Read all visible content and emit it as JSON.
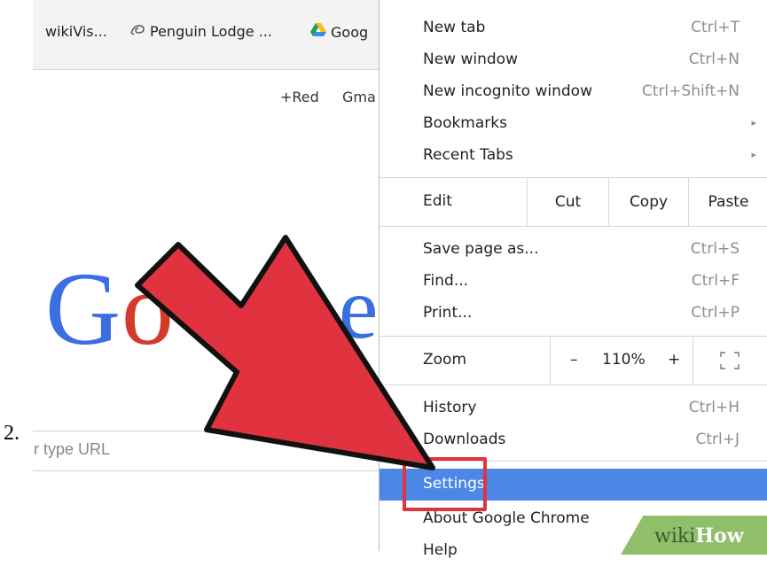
{
  "step": {
    "number": "2."
  },
  "bookmarks": {
    "items": [
      {
        "label": "wikiVis..."
      },
      {
        "label": "Penguin Lodge ..."
      },
      {
        "label": "Goog"
      }
    ]
  },
  "google_page": {
    "links": [
      "+Red",
      "Gma"
    ],
    "logo_visible_letters": [
      "G",
      "o",
      "e"
    ],
    "search_placeholder": "or type URL"
  },
  "menu": {
    "items_top": [
      {
        "label": "New tab",
        "shortcut": "Ctrl+T"
      },
      {
        "label": "New window",
        "shortcut": "Ctrl+N"
      },
      {
        "label": "New incognito window",
        "shortcut": "Ctrl+Shift+N"
      },
      {
        "label": "Bookmarks",
        "submenu": true
      },
      {
        "label": "Recent Tabs",
        "submenu": true
      }
    ],
    "edit": {
      "label": "Edit",
      "cut": "Cut",
      "copy": "Copy",
      "paste": "Paste"
    },
    "items_mid": [
      {
        "label": "Save page as...",
        "shortcut": "Ctrl+S"
      },
      {
        "label": "Find...",
        "shortcut": "Ctrl+F"
      },
      {
        "label": "Print...",
        "shortcut": "Ctrl+P"
      }
    ],
    "zoom": {
      "label": "Zoom",
      "minus": "–",
      "value": "110%",
      "plus": "+"
    },
    "items_bottom": [
      {
        "label": "History",
        "shortcut": "Ctrl+H"
      },
      {
        "label": "Downloads",
        "shortcut": "Ctrl+J"
      },
      {
        "label": "Settings",
        "highlighted": true
      },
      {
        "label": "About Google Chrome"
      },
      {
        "label": "Help"
      }
    ]
  },
  "watermark": {
    "prefix": "wiki",
    "suffix": "How"
  },
  "colors": {
    "arrow": "#e0333f",
    "highlight": "#4d87e6",
    "watermark": "#8fbf69"
  }
}
